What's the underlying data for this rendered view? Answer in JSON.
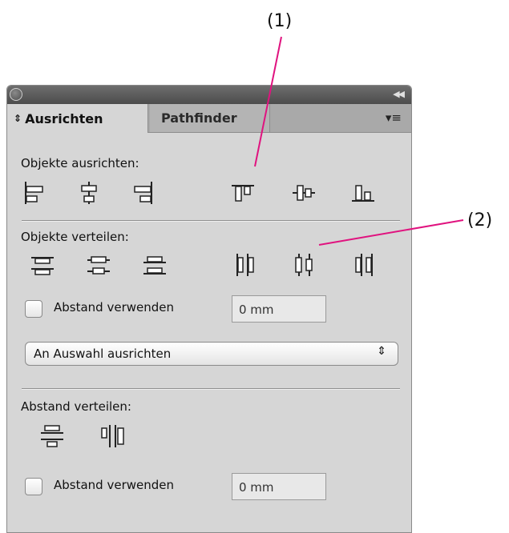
{
  "callouts": {
    "one": "(1)",
    "two": "(2)"
  },
  "tabs": {
    "active": {
      "sort_glyph": "◆",
      "label": "Ausrichten"
    },
    "inactive": "Pathfinder",
    "menu_icon": "panel-menu-icon"
  },
  "sections": {
    "align": {
      "label": "Objekte ausrichten:"
    },
    "distribute": {
      "label": "Objekte verteilen:"
    },
    "spacing": {
      "label": "Abstand verteilen:"
    }
  },
  "use_spacing_1": {
    "label": "Abstand verwenden",
    "value": "0 mm"
  },
  "align_to": {
    "value": "An Auswahl ausrichten"
  },
  "use_spacing_2": {
    "label": "Abstand verwenden",
    "value": "0 mm"
  },
  "colors": {
    "callout_line": "#e0137f",
    "panel_bg": "#d6d6d6"
  }
}
